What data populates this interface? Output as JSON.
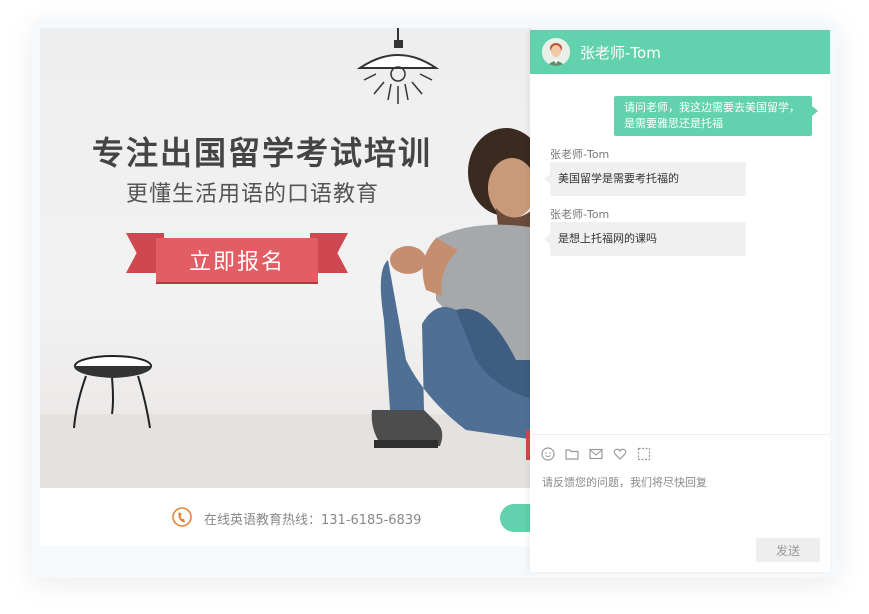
{
  "banner": {
    "headline": "专注出国留学考试培训",
    "subheadline": "更懂生活用语的口语教育",
    "cta_label": "立即报名"
  },
  "hotline": {
    "text": "在线英语教育热线：131-6185-6839",
    "icon": "phone-icon"
  },
  "chat": {
    "header_title": "张老师-Tom",
    "messages": [
      {
        "from": "user",
        "text_line1": "请问老师，我这边需要去美国留学，",
        "text_line2": "是需要雅思还是托福"
      },
      {
        "from": "teacher",
        "sender": "张老师-Tom",
        "text": "美国留学是需要考托福的"
      },
      {
        "from": "teacher",
        "sender": "张老师-Tom",
        "text": "是想上托福网的课吗"
      }
    ],
    "toolbar_icons": [
      "emoji-icon",
      "folder-icon",
      "mail-icon",
      "heart-icon",
      "screenshot-icon"
    ],
    "input_placeholder": "请反馈您的问题，我们将尽快回复",
    "send_label": "发送"
  },
  "colors": {
    "accent": "#62d1ad",
    "cta": "#e35d64"
  }
}
